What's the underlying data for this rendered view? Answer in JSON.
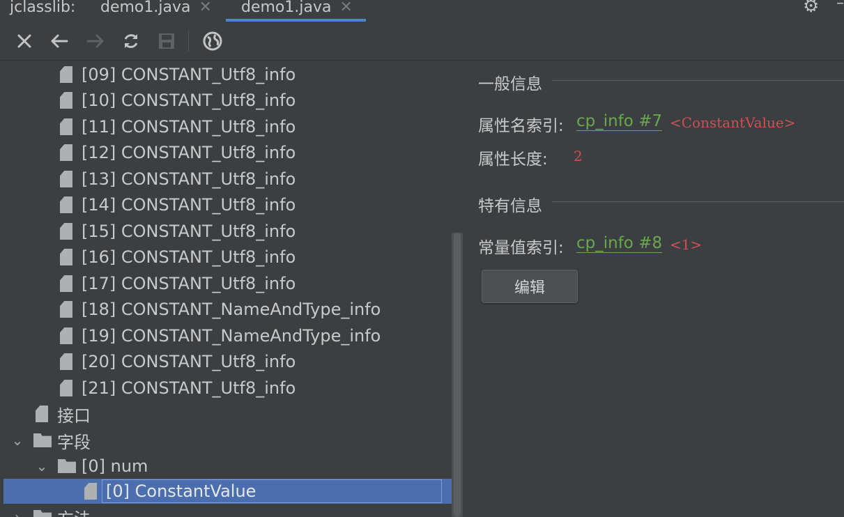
{
  "tabs": [
    {
      "label": "jclasslib:"
    },
    {
      "label": "demo1.java"
    },
    {
      "label": "demo1.java"
    }
  ],
  "toolbar": {
    "close_icon": "close-icon",
    "back_icon": "arrow-left-icon",
    "forward_icon": "arrow-right-icon",
    "refresh_icon": "refresh-icon",
    "save_icon": "save-icon",
    "web_icon": "globe-icon"
  },
  "tree": {
    "items": [
      {
        "label": "[09] CONSTANT_Utf8_info"
      },
      {
        "label": "[10] CONSTANT_Utf8_info"
      },
      {
        "label": "[11] CONSTANT_Utf8_info"
      },
      {
        "label": "[12] CONSTANT_Utf8_info"
      },
      {
        "label": "[13] CONSTANT_Utf8_info"
      },
      {
        "label": "[14] CONSTANT_Utf8_info"
      },
      {
        "label": "[15] CONSTANT_Utf8_info"
      },
      {
        "label": "[16] CONSTANT_Utf8_info"
      },
      {
        "label": "[17] CONSTANT_Utf8_info"
      },
      {
        "label": "[18] CONSTANT_NameAndType_info"
      },
      {
        "label": "[19] CONSTANT_NameAndType_info"
      },
      {
        "label": "[20] CONSTANT_Utf8_info"
      },
      {
        "label": "[21] CONSTANT_Utf8_info"
      },
      {
        "label": "接口"
      },
      {
        "label": "字段"
      },
      {
        "label": "[0] num"
      },
      {
        "label": "[0] ConstantValue"
      },
      {
        "label": "方法"
      }
    ]
  },
  "detail": {
    "general_title": "一般信息",
    "attr_name_label": "属性名索引:",
    "attr_name_link": "cp_info #7",
    "attr_name_value": "<ConstantValue>",
    "attr_len_label": "属性长度:",
    "attr_len_value": "2",
    "specific_title": "特有信息",
    "const_label": "常量值索引:",
    "const_link": "cp_info #8",
    "const_value": "<1>",
    "edit_button": "编辑"
  }
}
